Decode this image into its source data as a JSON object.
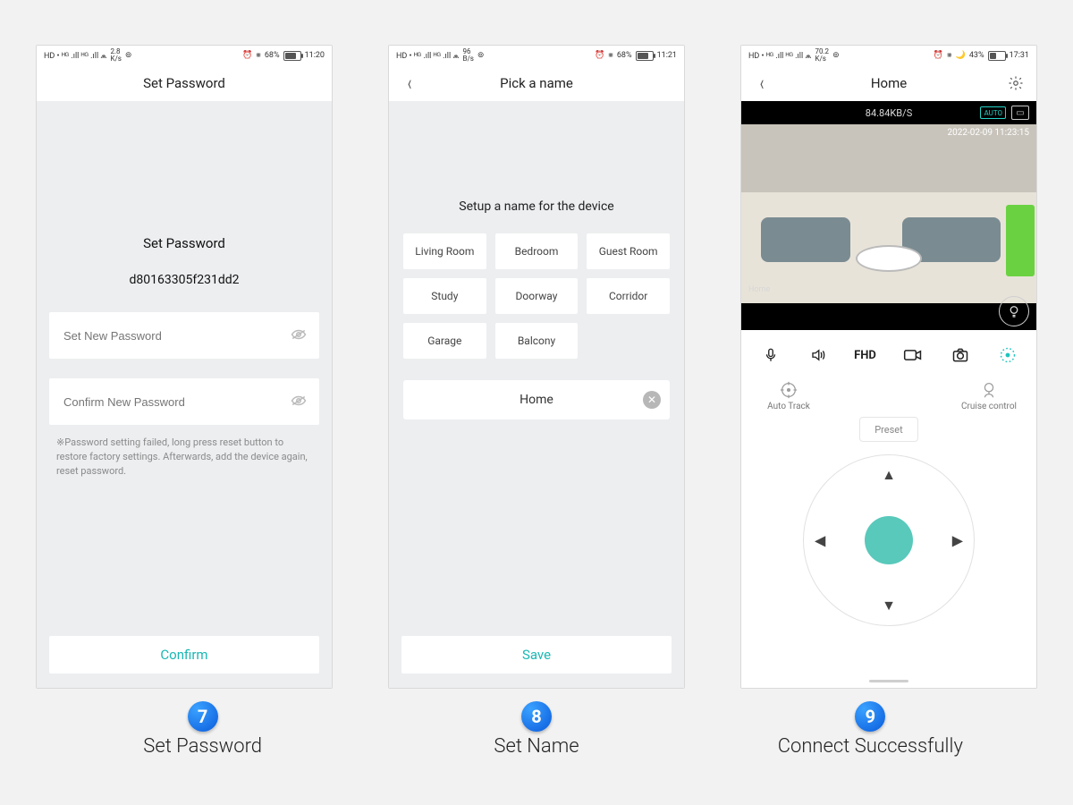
{
  "steps": {
    "s7": {
      "num": "7",
      "caption": "Set Password"
    },
    "s8": {
      "num": "8",
      "caption": "Set Name"
    },
    "s9": {
      "num": "9",
      "caption": "Connect Successfully"
    }
  },
  "status1": {
    "left": "HD • ᴴᴳ .ıll ᴴᴳ .ıll ⩕",
    "speed1": "2.8",
    "speedUnit": "K/s",
    "eye": "⊚",
    "alarm": "⏰",
    "bt": "⨳",
    "batt": "68%",
    "time": "11:20",
    "battFill": 68
  },
  "status2": {
    "left": "HD • ᴴᴳ .ıll ᴴᴳ .ıll ⩕",
    "speed1": "96",
    "speedUnit": "B/s",
    "eye": "⊚",
    "alarm": "⏰",
    "bt": "⨳",
    "batt": "68%",
    "time": "11:21",
    "battFill": 68
  },
  "status3": {
    "left": "HD • ᴴᴳ .ıll ᴴᴳ .ıll ⩕",
    "speed1": "70.2",
    "speedUnit": "K/s",
    "eye": "⊚",
    "alarm": "⏰",
    "bt": "⨳",
    "moon": "🌙",
    "batt": "43%",
    "time": "17:31",
    "battFill": 43
  },
  "p1": {
    "title": "Set Password",
    "heading": "Set Password",
    "deviceId": "d80163305f231dd2",
    "newPwPlaceholder": "Set New Password",
    "confirmPwPlaceholder": "Confirm New Password",
    "note": "※Password setting failed, long press reset button to restore factory settings. Afterwards, add the device again, reset password.",
    "confirm": "Confirm"
  },
  "p2": {
    "title": "Pick a name",
    "sub": "Setup a name for the device",
    "rooms": [
      "Living Room",
      "Bedroom",
      "Guest Room",
      "Study",
      "Doorway",
      "Corridor",
      "Garage",
      "Balcony"
    ],
    "value": "Home",
    "save": "Save"
  },
  "p3": {
    "title": "Home",
    "kbs": "84.84KB/S",
    "quality": "AUTO",
    "timestamp": "2022-02-09 11:23:15",
    "sceneLabel": "Home",
    "fhd": "FHD",
    "autoTrack": "Auto Track",
    "cruise": "Cruise control",
    "preset": "Preset"
  }
}
